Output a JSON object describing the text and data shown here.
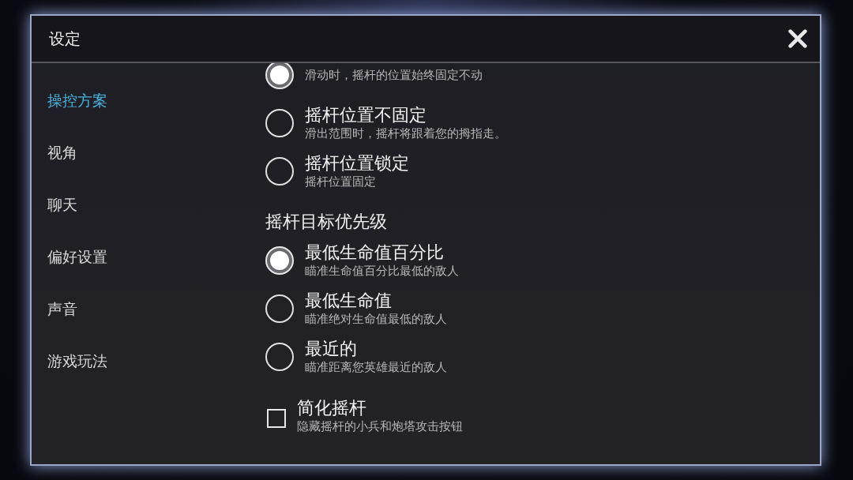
{
  "window": {
    "title": "设定"
  },
  "sidebar": {
    "items": [
      {
        "label": "操控方案",
        "selected": true
      },
      {
        "label": "视角",
        "selected": false
      },
      {
        "label": "聊天",
        "selected": false
      },
      {
        "label": "偏好设置",
        "selected": false
      },
      {
        "label": "声音",
        "selected": false
      },
      {
        "label": "游戏玩法",
        "selected": false
      }
    ]
  },
  "sections": [
    {
      "options": [
        {
          "kind": "radio",
          "description": "滑动时，摇杆的位置始终固定不动",
          "selected": true
        },
        {
          "kind": "radio",
          "title": "摇杆位置不固定",
          "description": "滑出范围时，摇杆将跟着您的拇指走。",
          "selected": false
        },
        {
          "kind": "radio",
          "title": "摇杆位置锁定",
          "description": "摇杆位置固定",
          "selected": false
        }
      ]
    },
    {
      "heading": "摇杆目标优先级",
      "options": [
        {
          "kind": "radio",
          "title": "最低生命值百分比",
          "description": "瞄准生命值百分比最低的敌人",
          "selected": true
        },
        {
          "kind": "radio",
          "title": "最低生命值",
          "description": "瞄准绝对生命值最低的敌人",
          "selected": false
        },
        {
          "kind": "radio",
          "title": "最近的",
          "description": "瞄准距离您英雄最近的敌人",
          "selected": false
        }
      ]
    },
    {
      "options": [
        {
          "kind": "checkbox",
          "title": "简化摇杆",
          "description": "隐藏摇杆的小兵和炮塔攻击按钮",
          "checked": false
        }
      ]
    }
  ]
}
